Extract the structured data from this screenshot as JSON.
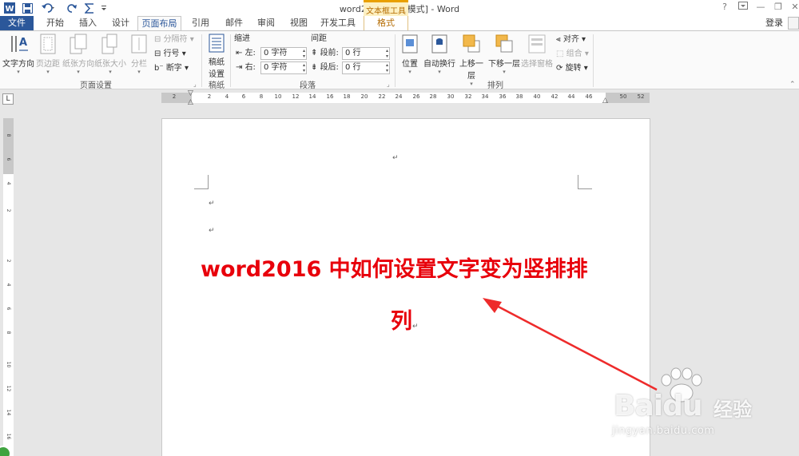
{
  "quick_access": {
    "word_icon": "W"
  },
  "window": {
    "title": "word2016 [兼容模式] - Word",
    "context_group_label": "文本框工具",
    "help": "?",
    "minimize": "—",
    "restore": "❐",
    "close": "✕"
  },
  "tabs": {
    "file": "文件",
    "home": "开始",
    "insert": "插入",
    "design": "设计",
    "layout": "页面布局",
    "references": "引用",
    "mailings": "邮件",
    "review": "审阅",
    "view": "视图",
    "developer": "开发工具",
    "format": "格式",
    "login": "登录"
  },
  "ribbon": {
    "page_setup": {
      "label": "页面设置",
      "text_direction": "文字方向",
      "margins": "页边距",
      "orientation": "纸张方向",
      "size": "纸张大小",
      "columns": "分栏",
      "breaks": "分隔符",
      "line_numbers": "行号",
      "hyphenation": "断字"
    },
    "manuscript": {
      "label": "稿纸",
      "button_line1": "稿纸",
      "button_line2": "设置"
    },
    "paragraph": {
      "label": "段落",
      "indent_title": "缩进",
      "spacing_title": "间距",
      "left_label": "左:",
      "right_label": "右:",
      "before_label": "段前:",
      "after_label": "段后:",
      "left_value": "0 字符",
      "right_value": "0 字符",
      "before_value": "0 行",
      "after_value": "0 行"
    },
    "arrange": {
      "label": "排列",
      "position": "位置",
      "wrap_text": "自动换行",
      "bring_forward": "上移一层",
      "send_backward": "下移一层",
      "selection_pane": "选择窗格",
      "align": "对齐",
      "group": "组合",
      "rotate": "旋转"
    }
  },
  "ruler": {
    "corner": "L",
    "h_ticks": [
      "2",
      "2",
      "4",
      "6",
      "8",
      "10",
      "12",
      "14",
      "16",
      "18",
      "20",
      "22",
      "24",
      "26",
      "28",
      "30",
      "32",
      "34",
      "36",
      "38",
      "40",
      "42",
      "44",
      "46",
      "50",
      "52"
    ],
    "v_ticks": [
      "8",
      "6",
      "4",
      "2",
      "2",
      "4",
      "6",
      "8",
      "10",
      "12",
      "14",
      "16"
    ]
  },
  "document": {
    "para_mark": "↵",
    "headline_line1": "word2016 中如何设置文字变为竖排排",
    "headline_line2": "列"
  },
  "watermark": {
    "brand": "Baidu",
    "cn": "经验",
    "url": "jingyan.baidu.com"
  }
}
